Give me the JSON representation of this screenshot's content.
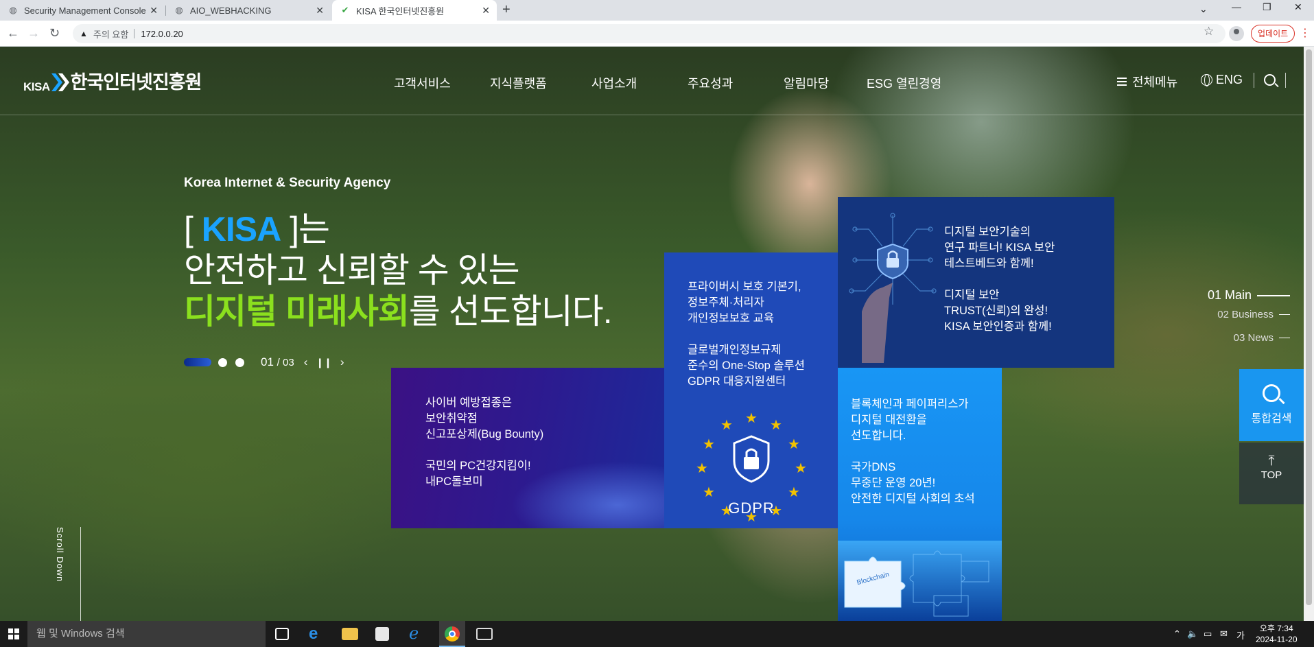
{
  "browser": {
    "tabs": [
      {
        "title": "Security Management Console",
        "active": false
      },
      {
        "title": "AIO_WEBHACKING",
        "active": false
      },
      {
        "title": "KISA 한국인터넷진흥원",
        "active": true
      }
    ],
    "address": {
      "warning": "주의 요함",
      "url": "172.0.0.20"
    },
    "update_label": "업데이트"
  },
  "site": {
    "logo_kisa": "KISA",
    "logo_name": "한국인터넷진흥원",
    "nav": [
      "고객서비스",
      "지식플랫폼",
      "사업소개",
      "주요성과",
      "알림마당",
      "ESG 열린경영"
    ],
    "all_menu": "전체메뉴",
    "lang": "ENG"
  },
  "hero": {
    "subtitle": "Korea Internet & Security Agency",
    "line1_open": "[ ",
    "line1_kisa": "KISA",
    "line1_close": " ]는",
    "line2": "안전하고 신뢰할 수 있는",
    "line3_green": "디지털 미래사회",
    "line3_rest": "를 선도합니다.",
    "page_current": "01",
    "page_total": "/ 03"
  },
  "tiles": {
    "purple": [
      "사이버 예방접종은\n보안취약점\n신고포상제(Bug Bounty)",
      "국민의 PC건강지킴이!\n내PC돌보미"
    ],
    "blue": [
      "프라이버시 보호 기본기,\n정보주체·처리자\n개인정보보호 교육",
      "글로벌개인정보규제\n준수의 One-Stop 솔루션\nGDPR 대응지원센터"
    ],
    "gdpr_label": "GDPR",
    "navy": [
      "디지털 보안기술의\n연구 파트너! KISA 보안\n테스트베드와 함께!",
      "디지털 보안\nTRUST(신뢰)의 완성!\nKISA 보안인증과 함께!"
    ],
    "sky": [
      "블록체인과 페이퍼리스가\n디지털 대전환을\n선도합니다.",
      "국가DNS\n무중단 운영 20년!\n안전한 디지털 사회의 초석"
    ],
    "puzzle_label": "Blockchain"
  },
  "side_nav": [
    {
      "num": "01",
      "label": "Main",
      "active": true
    },
    {
      "num": "02",
      "label": "Business",
      "active": false
    },
    {
      "num": "03",
      "label": "News",
      "active": false
    }
  ],
  "side_buttons": {
    "search": "통합검색",
    "top": "TOP"
  },
  "scroll_down": "Scroll Down",
  "taskbar": {
    "search_placeholder": "웹 및 Windows 검색",
    "time": "오후 7:34",
    "date": "2024-11-20"
  },
  "colors": {
    "kisa_blue": "#1aa3ff",
    "kisa_green": "#8be01e",
    "tile_purple": "#3b1184",
    "tile_blue": "#1f4ab8",
    "tile_navy": "#14357e",
    "tile_sky": "#1896f5"
  }
}
